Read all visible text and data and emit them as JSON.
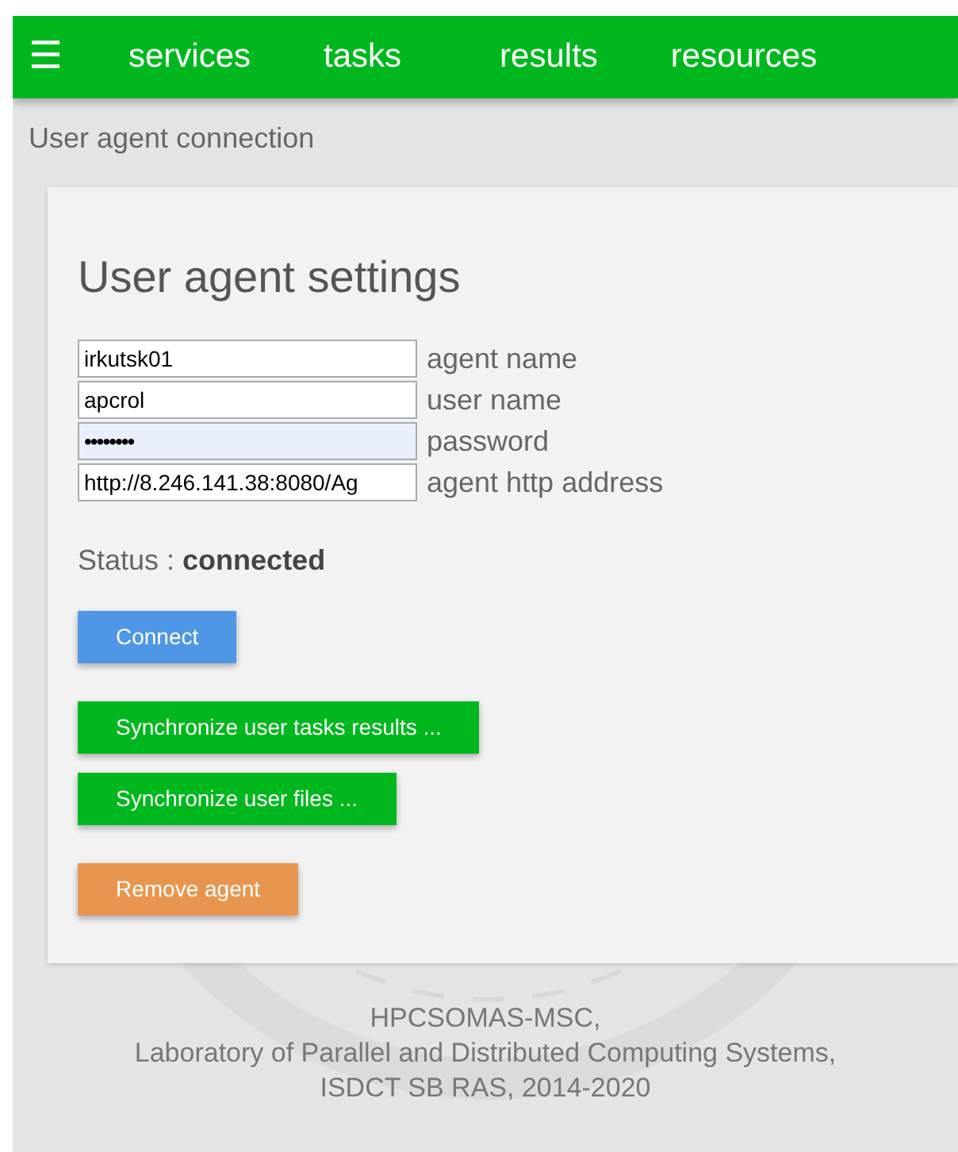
{
  "navbar": {
    "menu_icon": "☰",
    "items": [
      {
        "label": "services"
      },
      {
        "label": "tasks"
      },
      {
        "label": "results"
      },
      {
        "label": "resources"
      }
    ]
  },
  "breadcrumb": "User agent connection",
  "settings": {
    "title": "User agent settings",
    "fields": [
      {
        "kind": "text",
        "value": "irkutsk01",
        "label": "agent name",
        "autofilled": false
      },
      {
        "kind": "text",
        "value": "apcrol",
        "label": "user name",
        "autofilled": false
      },
      {
        "kind": "password",
        "value": "••••••••",
        "label": "password",
        "autofilled": true
      },
      {
        "kind": "text",
        "value": "http://8.246.141.38:8080/Ag",
        "label": "agent http address",
        "autofilled": false
      }
    ],
    "status_label": "Status :",
    "status_value": "connected",
    "buttons": [
      {
        "label": "Connect",
        "kind": "primary"
      },
      {
        "label": "Synchronize user tasks results ...",
        "kind": "sync"
      },
      {
        "label": "Synchronize user files ...",
        "kind": "sync"
      },
      {
        "label": "Remove agent",
        "kind": "danger"
      }
    ]
  },
  "footer": [
    "HPCSOMAS-MSC,",
    "Laboratory of Parallel and Distributed Computing Systems,",
    "ISDCT SB RAS, 2014-2020"
  ]
}
